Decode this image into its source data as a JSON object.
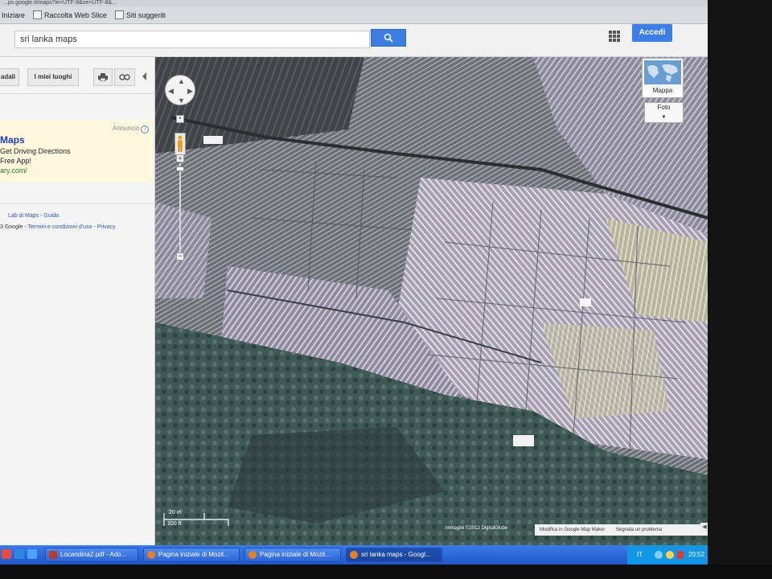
{
  "browser": {
    "url_fragment": "...ps.google.it/maps?ie=UTF-8&oe=UTF-8&...",
    "bookmarks": [
      {
        "label": "Iniziare"
      },
      {
        "label": "Raccolta Web Slice"
      },
      {
        "label": "Siti suggeriti"
      }
    ]
  },
  "header": {
    "search_value": "sri lanka maps",
    "signin_label": "Accedi"
  },
  "sidebar": {
    "tool_buttons": [
      "adali",
      "I miei luoghi"
    ],
    "ad": {
      "label": "Annuncio",
      "title": "Maps",
      "line1": "Get Driving Directions",
      "line2": "Free App!",
      "url": "ary.com/"
    },
    "footer_line1": {
      "lab": "Lab di Maps",
      "sep": " - ",
      "guide": "Guida"
    },
    "footer_line2": {
      "copy": "3 Google",
      "sep": " - ",
      "terms": "Termini e condizioni d'uso",
      "sep2": " - ",
      "privacy": "Privacy"
    }
  },
  "map": {
    "map_type_label": "Mappa",
    "photos_label": "Foto",
    "scale_metric": "20 m",
    "scale_imperial": "100 ft",
    "imagery_credit": "Immagini ©2013 DigitalGlobe",
    "edit_link": "Modifica in Google Map Maker",
    "report_link": "Segnala un problema"
  },
  "taskbar": {
    "items": [
      {
        "label": "Locandina2.pdf - Ado..."
      },
      {
        "label": "Pagina iniziale di Mozil..."
      },
      {
        "label": "Pagina iniziale di Mozil..."
      },
      {
        "label": "sri lanka maps - Googl..."
      }
    ],
    "lang": "IT",
    "clock": "20:52"
  }
}
